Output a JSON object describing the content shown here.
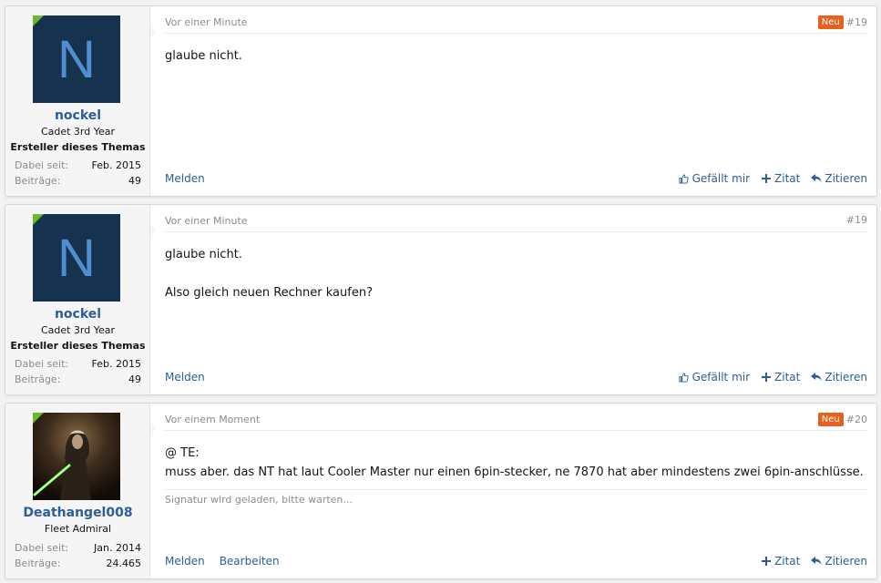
{
  "colors": {
    "link": "#2b5d9a",
    "badge_new": "#e8601c",
    "online_flag": "#6bb92d",
    "muted": "#8c8c8c"
  },
  "actions": {
    "report": "Melden",
    "edit": "Bearbeiten",
    "like": "Gefällt mir",
    "quote_add": "Zitat",
    "reply": "Zitieren"
  },
  "posts": [
    {
      "user": {
        "avatar_letter": "N",
        "name": "nockel",
        "title": "Cadet 3rd Year",
        "banner": "Ersteller dieses Themas",
        "joined_label": "Dabei seit:",
        "joined_value": "Feb. 2015",
        "posts_label": "Beiträge:",
        "posts_value": "49"
      },
      "date": "Vor einer Minute",
      "badge": "Neu",
      "number": "#19",
      "lines": [
        "glaube nicht."
      ]
    },
    {
      "user": {
        "avatar_letter": "N",
        "name": "nockel",
        "title": "Cadet 3rd Year",
        "banner": "Ersteller dieses Themas",
        "joined_label": "Dabei seit:",
        "joined_value": "Feb. 2015",
        "posts_label": "Beiträge:",
        "posts_value": "49"
      },
      "date": "Vor einer Minute",
      "number": "#19",
      "lines": [
        "glaube nicht.",
        "Also gleich neuen Rechner kaufen?"
      ]
    },
    {
      "user": {
        "name": "Deathangel008",
        "title": "Fleet Admiral",
        "joined_label": "Dabei seit:",
        "joined_value": "Jan. 2014",
        "posts_label": "Beiträge:",
        "posts_value": "24.465"
      },
      "date": "Vor einem Moment",
      "badge": "Neu",
      "number": "#20",
      "lines": [
        "@ TE:",
        "muss aber. das NT hat laut Cooler Master nur einen 6pin-stecker, ne 7870 hat aber mindestens zwei 6pin-anschlüsse."
      ],
      "signature": "Signatur wird geladen, bitte warten..."
    }
  ]
}
